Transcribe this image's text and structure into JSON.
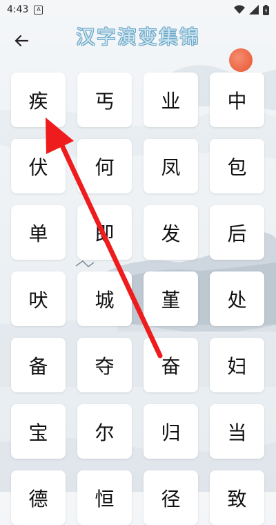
{
  "status_bar": {
    "time": "4:43",
    "notification_letter": "A",
    "wifi_icon": "wifi-icon",
    "signal_icon": "signal-icon",
    "battery_icon": "battery-icon"
  },
  "header": {
    "title": "汉字演变集锦",
    "back_icon": "back-arrow-icon"
  },
  "grid": {
    "characters": [
      "疾",
      "丐",
      "业",
      "中",
      "伏",
      "何",
      "凤",
      "包",
      "单",
      "即",
      "发",
      "后",
      "吠",
      "城",
      "堇",
      "处",
      "备",
      "夺",
      "奋",
      "妇",
      "宝",
      "尔",
      "归",
      "当",
      "德",
      "恒",
      "径",
      "致"
    ]
  },
  "colors": {
    "title_fill": "#cfe6f2",
    "title_stroke": "#6aa6c6",
    "sun": "#e8532d",
    "annotation_arrow": "#ee1c1c"
  }
}
